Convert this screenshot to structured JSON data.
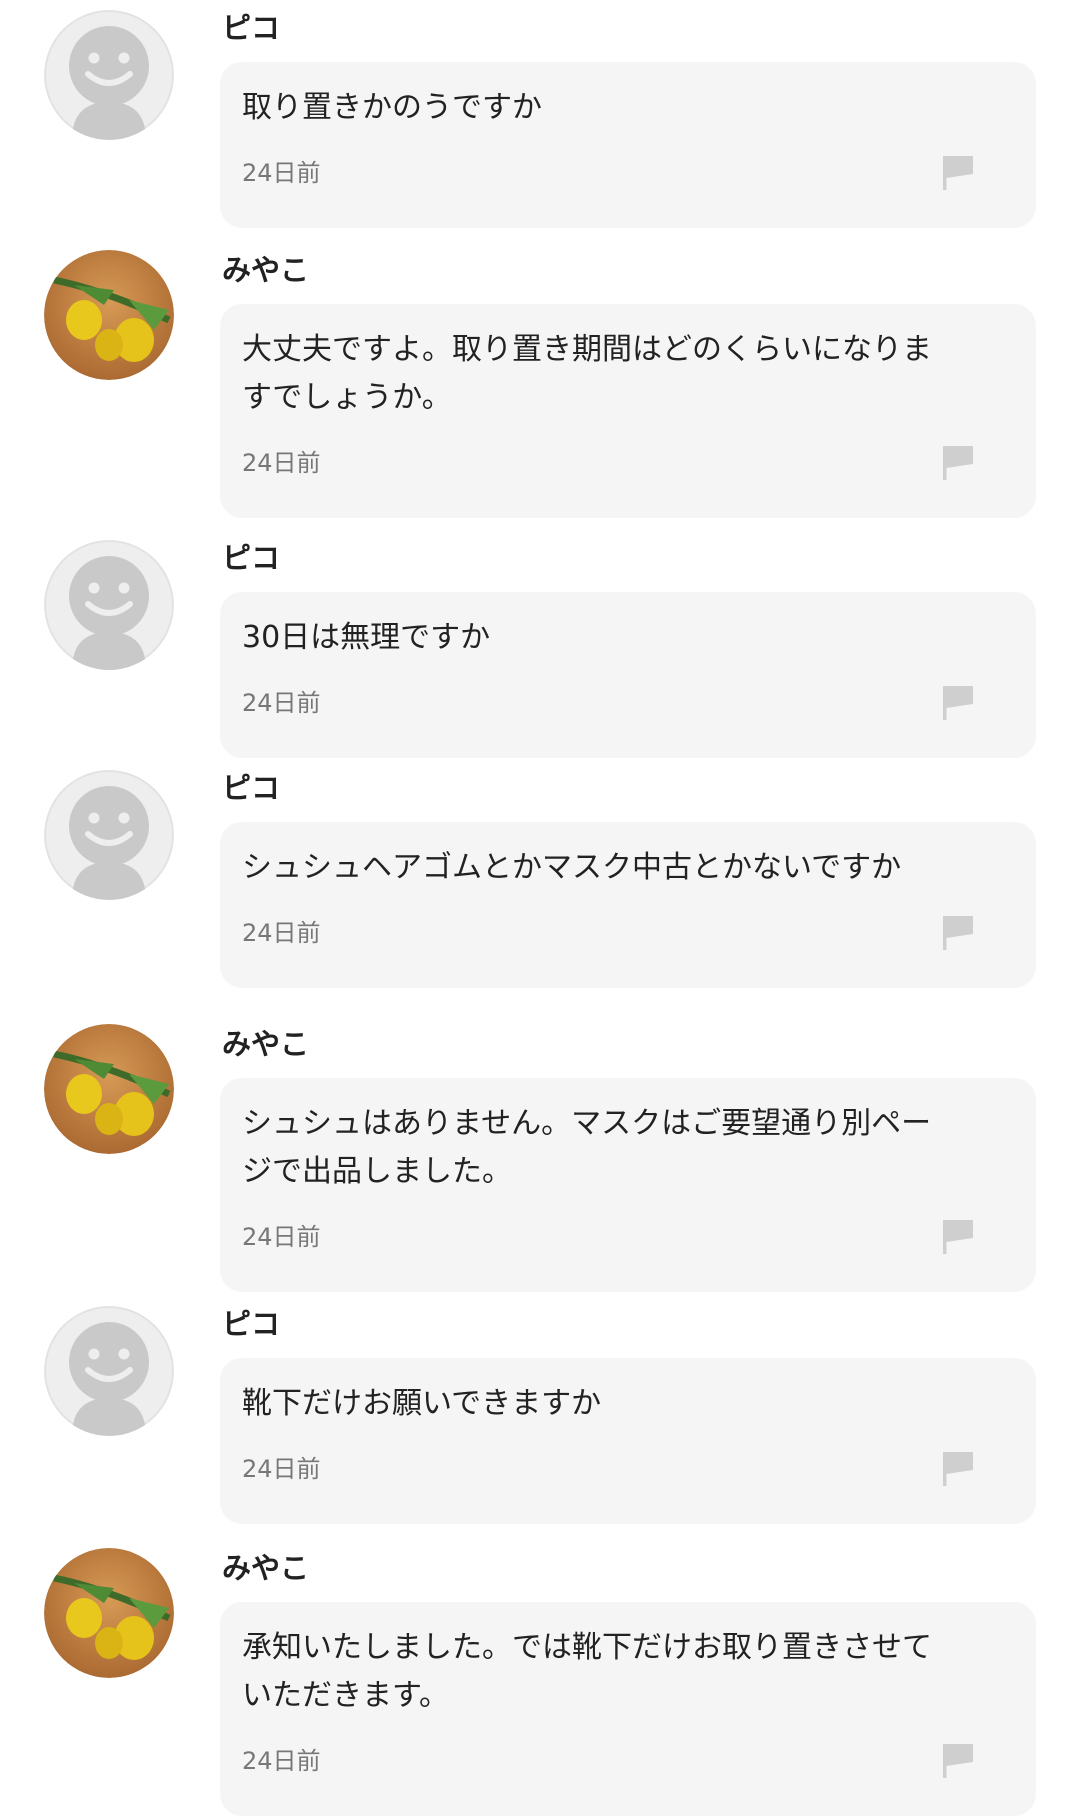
{
  "colors": {
    "bubble_bg": "#f5f5f5",
    "text": "#222222",
    "time_text": "#777777",
    "flag_icon": "#cfcfcf",
    "default_avatar_bg": "#eeeeee",
    "default_avatar_figure": "#c9c9c9"
  },
  "comments": [
    {
      "user": "ピコ",
      "avatar": "default-avatar-icon",
      "text": "取り置きかのうですか",
      "time": "24日前"
    },
    {
      "user": "みやこ",
      "avatar": "lemon-photo-avatar",
      "text": "大丈夫ですよ。取り置き期間はどのくらいになりま\nすでしょうか。",
      "time": "24日前"
    },
    {
      "user": "ピコ",
      "avatar": "default-avatar-icon",
      "text": "30日は無理ですか",
      "time": "24日前"
    },
    {
      "user": "ピコ",
      "avatar": "default-avatar-icon",
      "text": "シュシュヘアゴムとかマスク中古とかないですか",
      "time": "24日前"
    },
    {
      "user": "みやこ",
      "avatar": "lemon-photo-avatar",
      "text": "シュシュはありません。マスクはご要望通り別ペー\nジで出品しました。",
      "time": "24日前"
    },
    {
      "user": "ピコ",
      "avatar": "default-avatar-icon",
      "text": "靴下だけお願いできますか",
      "time": "24日前"
    },
    {
      "user": "みやこ",
      "avatar": "lemon-photo-avatar",
      "text": "承知いたしました。では靴下だけお取り置きさせて\nいただきます。",
      "time": "24日前"
    }
  ]
}
